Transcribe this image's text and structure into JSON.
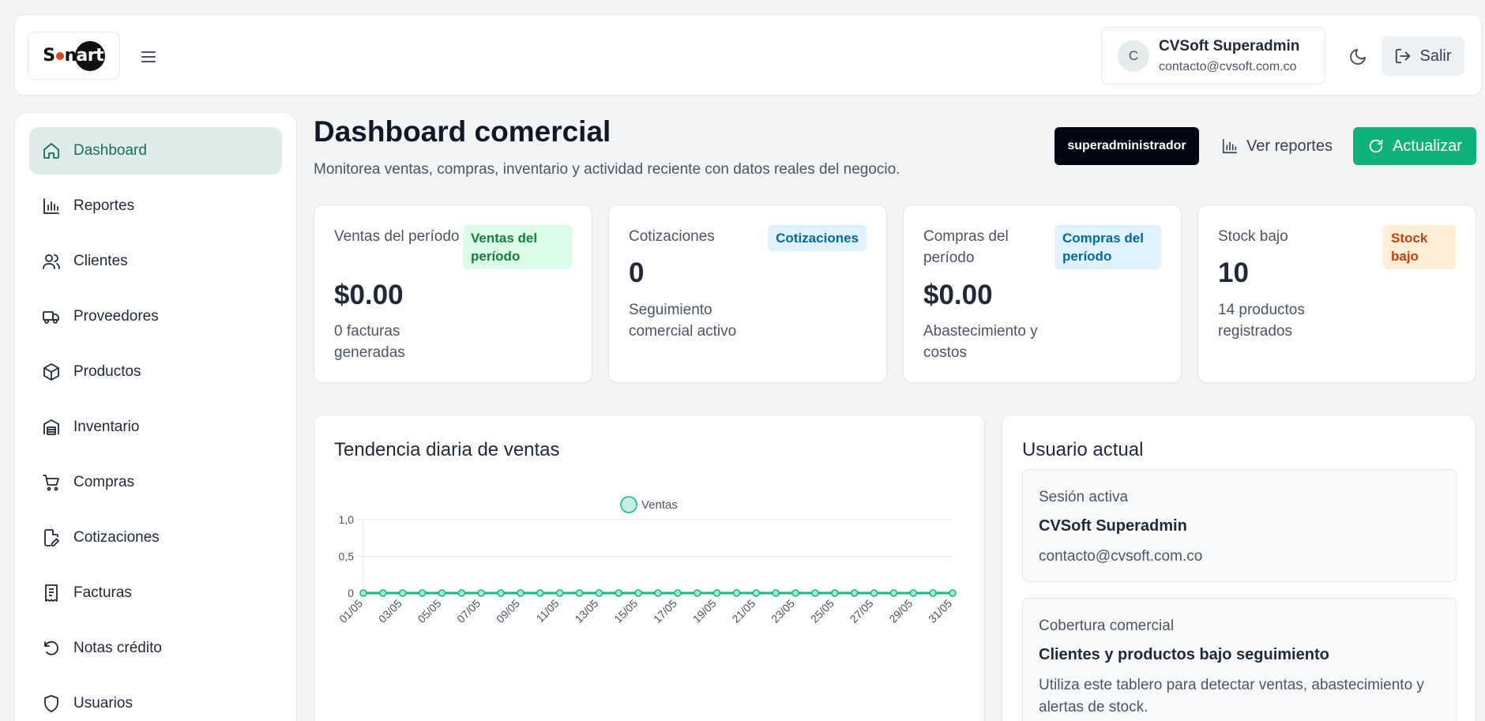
{
  "header": {
    "logo_text_a": "S",
    "logo_text_b": "n",
    "logo_text_c": "art",
    "user": {
      "initial": "C",
      "name": "CVSoft Superadmin",
      "email": "contacto@cvsoft.com.co"
    },
    "logout_label": "Salir"
  },
  "sidebar": {
    "items": [
      {
        "label": "Dashboard",
        "icon": "home-icon",
        "active": true
      },
      {
        "label": "Reportes",
        "icon": "bar-chart-icon"
      },
      {
        "label": "Clientes",
        "icon": "users-icon"
      },
      {
        "label": "Proveedores",
        "icon": "truck-icon"
      },
      {
        "label": "Productos",
        "icon": "box-icon"
      },
      {
        "label": "Inventario",
        "icon": "warehouse-icon"
      },
      {
        "label": "Compras",
        "icon": "cart-icon"
      },
      {
        "label": "Cotizaciones",
        "icon": "file-edit-icon"
      },
      {
        "label": "Facturas",
        "icon": "receipt-icon"
      },
      {
        "label": "Notas crédito",
        "icon": "undo-icon"
      },
      {
        "label": "Usuarios",
        "icon": "shield-icon"
      }
    ]
  },
  "main": {
    "title": "Dashboard comercial",
    "subtitle": "Monitorea ventas, compras, inventario y actividad reciente con datos reales del negocio.",
    "role_badge": "superadministrador",
    "reports_label": "Ver reportes",
    "refresh_label": "Actualizar"
  },
  "stats": [
    {
      "label": "Ventas del período",
      "badge": "Ventas del período",
      "value": "$0.00",
      "desc": "0 facturas generadas",
      "badge_bg": "#dcfce7",
      "badge_fg": "#15803d"
    },
    {
      "label": "Cotizaciones",
      "badge": "Cotizaciones",
      "value": "0",
      "desc": "Seguimiento comercial activo",
      "badge_bg": "#e0f2fe",
      "badge_fg": "#0369a1"
    },
    {
      "label": "Compras del período",
      "badge": "Compras del período",
      "value": "$0.00",
      "desc": "Abastecimiento y costos",
      "badge_bg": "#e0f2fe",
      "badge_fg": "#0369a1"
    },
    {
      "label": "Stock bajo",
      "badge": "Stock bajo",
      "value": "10",
      "desc": "14 productos registrados",
      "badge_bg": "#ffedd5",
      "badge_fg": "#c2410c"
    }
  ],
  "chart_panel": {
    "title": "Tendencia diaria de ventas"
  },
  "chart_data": {
    "type": "line",
    "title": "",
    "xlabel": "",
    "ylabel": "",
    "legend_position": "top",
    "grid": true,
    "ylim": [
      0,
      1
    ],
    "y_ticks": [
      "1,0",
      "0,5",
      "0"
    ],
    "x": [
      "01/05",
      "02/05",
      "03/05",
      "04/05",
      "05/05",
      "06/05",
      "07/05",
      "08/05",
      "09/05",
      "10/05",
      "11/05",
      "12/05",
      "13/05",
      "14/05",
      "15/05",
      "16/05",
      "17/05",
      "18/05",
      "19/05",
      "20/05",
      "21/05",
      "22/05",
      "23/05",
      "24/05",
      "25/05",
      "26/05",
      "27/05",
      "28/05",
      "29/05",
      "30/05",
      "31/05"
    ],
    "x_tick_labels": [
      "01/05",
      "03/05",
      "05/05",
      "07/05",
      "09/05",
      "11/05",
      "13/05",
      "15/05",
      "17/05",
      "19/05",
      "21/05",
      "23/05",
      "25/05",
      "27/05",
      "29/05",
      "31/05"
    ],
    "series": [
      {
        "name": "Ventas",
        "color": "#10b981",
        "values": [
          0,
          0,
          0,
          0,
          0,
          0,
          0,
          0,
          0,
          0,
          0,
          0,
          0,
          0,
          0,
          0,
          0,
          0,
          0,
          0,
          0,
          0,
          0,
          0,
          0,
          0,
          0,
          0,
          0,
          0,
          0
        ]
      }
    ]
  },
  "user_panel": {
    "title": "Usuario actual",
    "session": {
      "label": "Sesión activa",
      "name": "CVSoft Superadmin",
      "email": "contacto@cvsoft.com.co"
    },
    "coverage": {
      "label": "Cobertura comercial",
      "heading": "Clientes y productos bajo seguimiento",
      "text": "Utiliza este tablero para detectar ventas, abastecimiento y alertas de stock."
    }
  }
}
